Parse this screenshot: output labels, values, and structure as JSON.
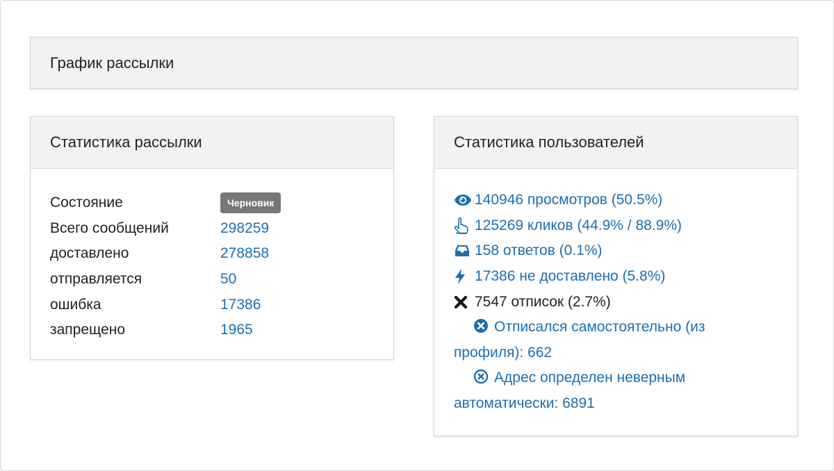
{
  "chart_panel": {
    "title": "График рассылки"
  },
  "mail_stats": {
    "title": "Статистика рассылки",
    "rows": [
      {
        "label": "Состояние",
        "badge": "Черновик"
      },
      {
        "label": "Всего сообщений",
        "value": "298259"
      },
      {
        "label": "доставлено",
        "value": "278858"
      },
      {
        "label": "отправляется",
        "value": "50"
      },
      {
        "label": "ошибка",
        "value": "17386"
      },
      {
        "label": "запрещено",
        "value": "1965"
      }
    ]
  },
  "user_stats": {
    "title": "Статистика пользователей",
    "views": {
      "icon": "eye-icon",
      "text": "140946 просмотров (50.5%)"
    },
    "clicks": {
      "icon": "pointer-hand-icon",
      "text": "125269 кликов (44.9% / 88.9%)"
    },
    "replies": {
      "icon": "inbox-icon",
      "text": "158 ответов (0.1%)"
    },
    "undelivered": {
      "icon": "bolt-icon",
      "text": "17386 не доставлено (5.8%)"
    },
    "unsubscribes": {
      "icon": "x-mark-icon",
      "text": "7547 отписок (2.7%)"
    },
    "self_unsub": {
      "icon": "circle-x-filled-icon",
      "line1": "Отписался самостоятельно (из",
      "line2": "профиля): 662"
    },
    "auto_invalid": {
      "icon": "circle-x-outline-icon",
      "line1": "Адрес определен неверным",
      "line2": "автоматически: 6891"
    }
  },
  "colors": {
    "link": "#1c6fae",
    "badge": "#777777",
    "header_bg": "#f2f2f2"
  }
}
